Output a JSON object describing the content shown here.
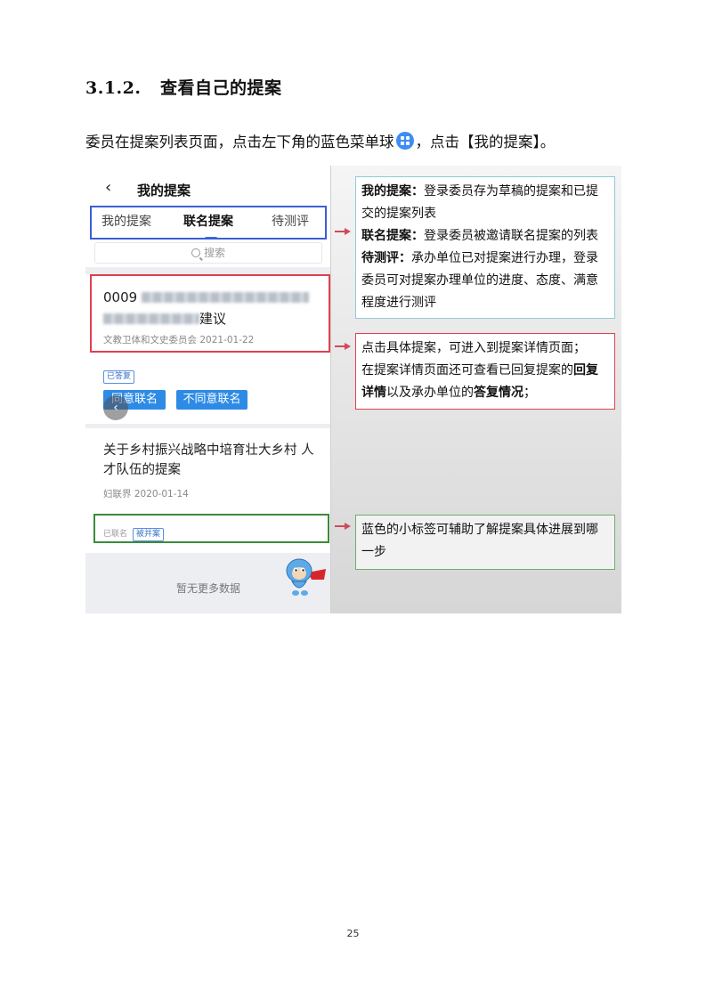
{
  "section": {
    "number": "3.1.2.",
    "title": "查看自己的提案"
  },
  "intro": {
    "before": "委员在提案列表页面，点击左下角的蓝色菜单球",
    "after": "，点击【我的提案】。"
  },
  "phone": {
    "title": "我的提案",
    "tabs": [
      {
        "label": "我的提案",
        "active": false
      },
      {
        "label": "联名提案",
        "active": true
      },
      {
        "label": "待测评",
        "active": false
      }
    ],
    "search_placeholder": "搜索",
    "proposal1": {
      "number": "0009",
      "title_end": "建议",
      "meta": "文教卫体和文史委员会  2021-01-22",
      "tag": "已答复",
      "agree_button": "同意联名",
      "disagree_button": "不同意联名"
    },
    "proposal2": {
      "title": "关于乡村振兴战略中培育壮大乡村 人才队伍的提案",
      "meta": "妇联界  2020-01-14",
      "status": "已联名",
      "tag": "被并案"
    },
    "no_more": "暂无更多数据"
  },
  "notes": {
    "note1": [
      {
        "term": "我的提案：",
        "text": "登录委员存为草稿的提案和已提交的提案列表"
      },
      {
        "term": "联名提案：",
        "text": "登录委员被邀请联名提案的列表"
      },
      {
        "term": "待测评：",
        "text": "承办单位已对提案进行办理，登录委员可对提案办理单位的进度、态度、满意程度进行测评"
      }
    ],
    "note2": {
      "line1": "点击具体提案，可进入到提案详情页面；",
      "line2_a": "在提案详情页面还可查看已回复提案的",
      "line2_b": "回复详情",
      "line2_c": "以及承办单位的",
      "line2_d": "答复情况",
      "line2_e": "；"
    },
    "note3": "蓝色的小标签可辅助了解提案具体进展到哪一步"
  },
  "colors": {
    "tab_box": "#3b5fd4",
    "card_box": "#e0404f",
    "tag_box": "#3c8a3c",
    "accent_blue": "#2d8be6"
  },
  "page_number": "25"
}
